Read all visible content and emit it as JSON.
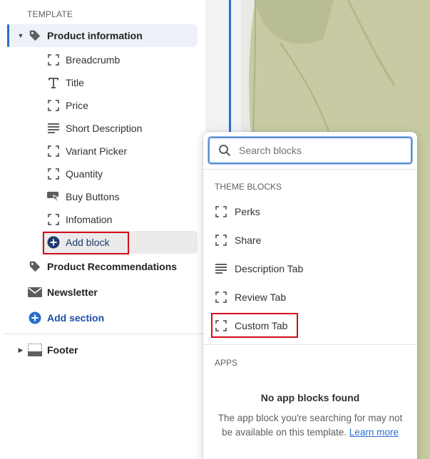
{
  "sidebar": {
    "section_label": "TEMPLATE",
    "product_information": "Product information",
    "blocks": [
      {
        "label": "Breadcrumb",
        "icon": "bracket-icon"
      },
      {
        "label": "Title",
        "icon": "title-t-icon"
      },
      {
        "label": "Price",
        "icon": "bracket-icon"
      },
      {
        "label": "Short Description",
        "icon": "text-lines-icon"
      },
      {
        "label": "Variant Picker",
        "icon": "bracket-icon"
      },
      {
        "label": "Quantity",
        "icon": "bracket-icon"
      },
      {
        "label": "Buy Buttons",
        "icon": "buy-button-icon"
      },
      {
        "label": "Infomation",
        "icon": "bracket-icon"
      }
    ],
    "add_block": "Add block",
    "product_recommendations": "Product Recommendations",
    "newsletter": "Newsletter",
    "add_section": "Add section",
    "footer": "Footer"
  },
  "popup": {
    "search_placeholder": "Search blocks",
    "theme_blocks_heading": "THEME BLOCKS",
    "theme_blocks": [
      "Perks",
      "Share",
      "Description Tab",
      "Review Tab",
      "Custom Tab"
    ],
    "apps_heading": "APPS",
    "no_apps_title": "No app blocks found",
    "no_apps_text": "The app block you're searching for may not be available on this template.",
    "learn_more": "Learn more"
  },
  "colors": {
    "accent": "#2c6ecb",
    "highlight_box": "#d40c1a",
    "shirt": "#c7caa2"
  }
}
